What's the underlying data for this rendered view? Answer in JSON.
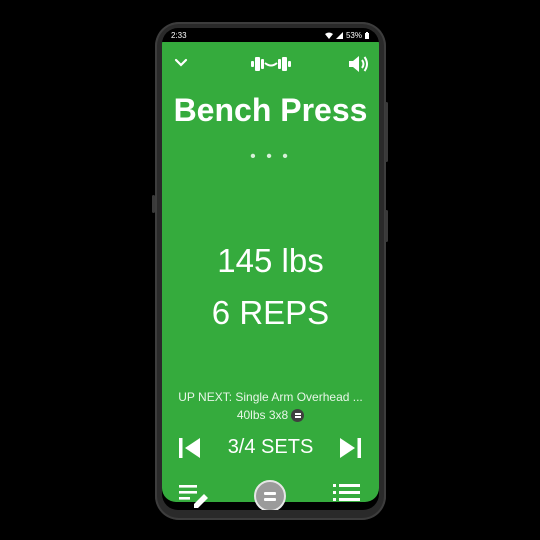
{
  "status_bar": {
    "time": "2:33",
    "battery": "53%"
  },
  "header": {
    "collapse_icon": "chevron-down-icon",
    "logo_icon": "dumbbell-icon",
    "sound_icon": "volume-icon"
  },
  "exercise": {
    "title": "Bench Press",
    "more": "• • •",
    "weight": "145 lbs",
    "reps": "6 REPS"
  },
  "up_next": {
    "label": "UP NEXT: Single Arm Overhead ...",
    "detail": "40lbs 3x8"
  },
  "sets": {
    "label": "3/4 SETS"
  },
  "bottom_bar": {
    "left_icon": "edit-list-icon",
    "center_icon": "menu-button-icon",
    "right_icon": "list-icon"
  },
  "colors": {
    "background": "#35AB3D",
    "text": "#FFFFFF"
  }
}
